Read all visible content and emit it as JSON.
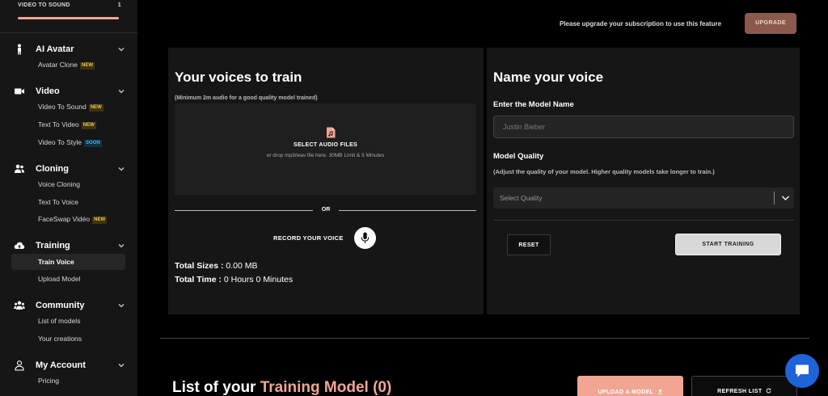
{
  "sidebar": {
    "progress": {
      "label": "VIDEO TO SOUND",
      "count": "1"
    },
    "sections": {
      "ai_avatar": {
        "label": "AI Avatar",
        "items": {
          "avatar_clone": "Avatar Clone"
        }
      },
      "video": {
        "label": "Video",
        "items": {
          "video_to_sound": "Video To Sound",
          "text_to_video": "Text To Video",
          "video_to_style": "Video To Style"
        }
      },
      "cloning": {
        "label": "Cloning",
        "items": {
          "voice_cloning": "Voice Cloning",
          "text_to_voice": "Text To Voice",
          "faceswap_video": "FaceSwap Vidéo"
        }
      },
      "training": {
        "label": "Training",
        "items": {
          "train_voice": "Train Voice",
          "upload_model": "Upload Model"
        }
      },
      "community": {
        "label": "Community",
        "items": {
          "list_of_models": "List of models",
          "your_creations": "Your creations"
        }
      },
      "my_account": {
        "label": "My Account",
        "items": {
          "pricing": "Pricing"
        }
      }
    },
    "badges": {
      "new": "NEW",
      "soon": "SOON"
    }
  },
  "header": {
    "upgrade_message": "Please upgrade your subscription to use this feature",
    "upgrade_button": "UPGRADE"
  },
  "train_panel": {
    "title": "Your voices to train",
    "note": "(Minimum 2m audio for a good quality model trained)",
    "dropzone_title": "SELECT AUDIO FILES",
    "dropzone_subtitle": "or drop mp3/wav file here. 30MB Limit & 5 Minutes",
    "or_label": "OR",
    "record_label": "RECORD YOUR VOICE",
    "total_sizes_label": "Total Sizes :",
    "total_sizes_value": "0.00 MB",
    "total_time_label": "Total Time :",
    "total_time_value": "0 Hours 0 Minutes"
  },
  "name_panel": {
    "title": "Name your voice",
    "model_name_label": "Enter the Model Name",
    "model_name_placeholder": "Justin Bieber",
    "model_quality_label": "Model Quality",
    "model_quality_note": "(Adjust the quality of your model. Higher quality models take longer to train.)",
    "quality_select_value": "Select Quality",
    "reset_button": "RESET",
    "start_button": "START TRAINING"
  },
  "models_list": {
    "title_prefix": "List of your",
    "title_accent": "Training Model (0)",
    "upload_button": "UPLOAD A MODEL",
    "refresh_button": "REFRESH LIST"
  },
  "colors": {
    "accent": "#f0a693",
    "upgrade_button": "#8b5a4e",
    "new_badge": "#e9c253",
    "soon_badge": "#3fb6e0",
    "chat_button": "#1e63d8"
  },
  "icons": {
    "ai_avatar": "person-icon",
    "video": "video-camera-icon",
    "cloning": "users-icon",
    "training": "cloud-upload-icon",
    "community": "group-icon",
    "my_account": "user-outline-icon",
    "dropzone": "audio-file-icon",
    "record": "microphone-icon",
    "chat": "chat-icon"
  }
}
